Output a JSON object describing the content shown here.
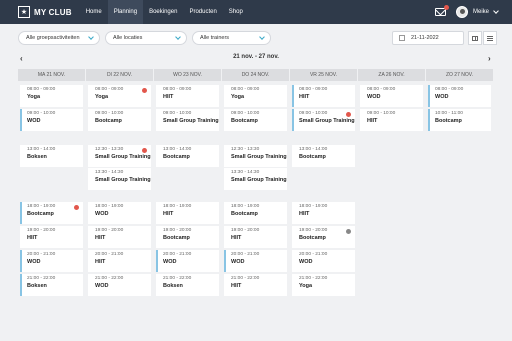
{
  "nav": {
    "logo": "MY CLUB",
    "items": [
      {
        "label": "Home"
      },
      {
        "label": "Planning",
        "active": true
      },
      {
        "label": "Boekingen"
      },
      {
        "label": "Producten"
      },
      {
        "label": "Shop"
      }
    ],
    "username": "Meike"
  },
  "filters": [
    {
      "label": "Alle groepsactiviteiten"
    },
    {
      "label": "Alle locaties"
    },
    {
      "label": "Alle trainers"
    }
  ],
  "date_input": "21-11-2022",
  "week_label": "21 nov. - 27 nov.",
  "days": [
    "MA 21 NOV.",
    "DI 22 NOV.",
    "WO 23 NOV.",
    "DO 24 NOV.",
    "VR 25 NOV.",
    "ZA 26 NOV.",
    "ZO 27 NOV."
  ],
  "colors": {
    "accent": "#88c4e4",
    "nav": "#2f3a4a",
    "alert": "#e2574c"
  },
  "events": [
    {
      "day": 0,
      "slot": 0,
      "time": "08:00 - 09:00",
      "title": "Yoga"
    },
    {
      "day": 0,
      "slot": 1,
      "time": "09:00 - 10:00",
      "title": "WOD",
      "accent": true
    },
    {
      "day": 0,
      "slot": 2,
      "time": "13:00 - 14:00",
      "title": "Boksen"
    },
    {
      "day": 0,
      "slot": 4,
      "time": "18:00 - 19:00",
      "title": "Bootcamp",
      "accent": true,
      "dot": "red"
    },
    {
      "day": 0,
      "slot": 5,
      "time": "19:00 - 20:00",
      "title": "HIIT"
    },
    {
      "day": 0,
      "slot": 6,
      "time": "20:00 - 21:00",
      "title": "WOD",
      "accent": true
    },
    {
      "day": 0,
      "slot": 7,
      "time": "21:00 - 22:00",
      "title": "Boksen",
      "accent": true
    },
    {
      "day": 1,
      "slot": 0,
      "time": "08:00 - 09:00",
      "title": "Yoga",
      "dot": "red"
    },
    {
      "day": 1,
      "slot": 1,
      "time": "09:00 - 10:00",
      "title": "Bootcamp"
    },
    {
      "day": 1,
      "slot": 2,
      "time": "12:30 - 13:30",
      "title": "Small Group Training",
      "dot": "red"
    },
    {
      "day": 1,
      "slot": 3,
      "time": "13:30 - 14:30",
      "title": "Small Group Training"
    },
    {
      "day": 1,
      "slot": 4,
      "time": "18:00 - 19:00",
      "title": "WOD"
    },
    {
      "day": 1,
      "slot": 5,
      "time": "19:00 - 20:00",
      "title": "HIIT"
    },
    {
      "day": 1,
      "slot": 6,
      "time": "20:00 - 21:00",
      "title": "HIIT"
    },
    {
      "day": 1,
      "slot": 7,
      "time": "21:00 - 22:00",
      "title": "WOD"
    },
    {
      "day": 2,
      "slot": 0,
      "time": "08:00 - 09:00",
      "title": "HIIT"
    },
    {
      "day": 2,
      "slot": 1,
      "time": "09:00 - 10:00",
      "title": "Small Group Training"
    },
    {
      "day": 2,
      "slot": 2,
      "time": "13:00 - 14:00",
      "title": "Bootcamp"
    },
    {
      "day": 2,
      "slot": 4,
      "time": "18:00 - 19:00",
      "title": "HIIT"
    },
    {
      "day": 2,
      "slot": 5,
      "time": "19:00 - 20:00",
      "title": "Bootcamp"
    },
    {
      "day": 2,
      "slot": 6,
      "time": "20:00 - 21:00",
      "title": "WOD",
      "accent": true
    },
    {
      "day": 2,
      "slot": 7,
      "time": "21:00 - 22:00",
      "title": "Boksen"
    },
    {
      "day": 3,
      "slot": 0,
      "time": "08:00 - 09:00",
      "title": "Yoga"
    },
    {
      "day": 3,
      "slot": 1,
      "time": "09:00 - 10:00",
      "title": "Bootcamp"
    },
    {
      "day": 3,
      "slot": 2,
      "time": "12:30 - 13:30",
      "title": "Small Group Training"
    },
    {
      "day": 3,
      "slot": 3,
      "time": "13:30 - 14:30",
      "title": "Small Group Training"
    },
    {
      "day": 3,
      "slot": 4,
      "time": "18:00 - 19:00",
      "title": "Bootcamp"
    },
    {
      "day": 3,
      "slot": 5,
      "time": "19:00 - 20:00",
      "title": "HIIT"
    },
    {
      "day": 3,
      "slot": 6,
      "time": "20:00 - 21:00",
      "title": "WOD",
      "accent": true
    },
    {
      "day": 3,
      "slot": 7,
      "time": "21:00 - 22:00",
      "title": "HIIT"
    },
    {
      "day": 4,
      "slot": 0,
      "time": "08:00 - 09:00",
      "title": "HIIT",
      "accent": true
    },
    {
      "day": 4,
      "slot": 1,
      "time": "09:00 - 10:00",
      "title": "Small Group Training",
      "accent": true,
      "dot": "red"
    },
    {
      "day": 4,
      "slot": 2,
      "time": "13:00 - 14:00",
      "title": "Bootcamp"
    },
    {
      "day": 4,
      "slot": 4,
      "time": "18:00 - 19:00",
      "title": "HIIT"
    },
    {
      "day": 4,
      "slot": 5,
      "time": "19:00 - 20:00",
      "title": "Bootcamp",
      "dot": "grey"
    },
    {
      "day": 4,
      "slot": 6,
      "time": "20:00 - 21:00",
      "title": "WOD"
    },
    {
      "day": 4,
      "slot": 7,
      "time": "21:00 - 22:00",
      "title": "Yoga"
    },
    {
      "day": 5,
      "slot": 0,
      "time": "08:00 - 09:00",
      "title": "WOD"
    },
    {
      "day": 5,
      "slot": 1,
      "time": "09:00 - 10:00",
      "title": "HIIT"
    },
    {
      "day": 6,
      "slot": 0,
      "time": "08:00 - 09:00",
      "title": "WOD",
      "accent": true
    },
    {
      "day": 6,
      "slot": 1,
      "time": "10:00 - 11:00",
      "title": "Bootcamp",
      "accent": true
    }
  ]
}
